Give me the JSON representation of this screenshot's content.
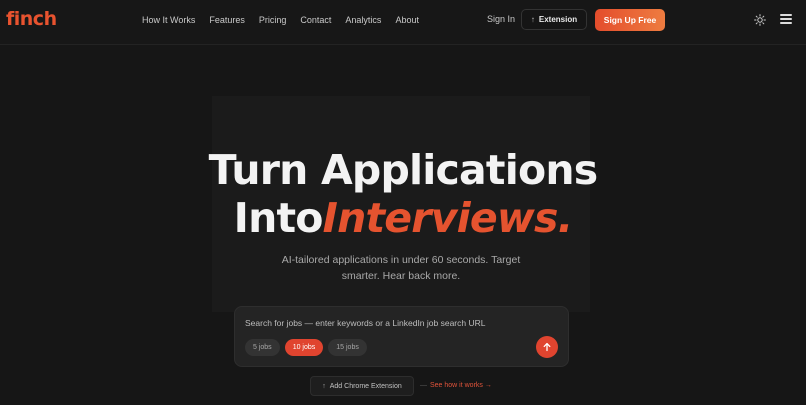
{
  "brand": {
    "name": "finch",
    "accent": "#e5532f"
  },
  "nav": {
    "items": [
      "How It Works",
      "Features",
      "Pricing",
      "Contact",
      "Analytics",
      "About"
    ]
  },
  "header": {
    "sign_in": "Sign In",
    "extension_label": "Extension",
    "extension_icon": "arrow-up-icon",
    "signup_label": "Sign Up Free",
    "theme_icon": "sun-icon",
    "menu_icon": "hamburger-menu-icon"
  },
  "hero": {
    "line1": "Turn Applications",
    "line2_plain": "Into",
    "line2_accent": "Interviews.",
    "subtitle": "AI-tailored applications in under 60 seconds. Target smarter. Hear back more."
  },
  "search": {
    "placeholder": "Search for jobs — enter keywords or a LinkedIn job search URL",
    "chips": [
      "5 jobs",
      "10 jobs",
      "15 jobs"
    ],
    "selected_chip": "10 jobs",
    "submit_icon": "arrow-up-icon"
  },
  "footer_actions": {
    "chrome_label": "Add Chrome Extension",
    "chrome_icon": "arrow-up-icon",
    "see_how_label": "See how it works →"
  }
}
